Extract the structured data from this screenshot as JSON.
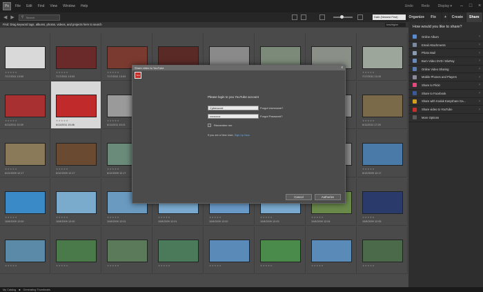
{
  "app": {
    "logo_text": "Ps"
  },
  "menubar": {
    "items": [
      "File",
      "Edit",
      "Find",
      "View",
      "Window",
      "Help"
    ],
    "undo": "Undo",
    "redo": "Redo",
    "display": "Display ▾"
  },
  "toolbar": {
    "search_placeholder": "Search",
    "sort_value": "Date (Newest First)"
  },
  "hint": {
    "text": "Find: Drag keyword tags, albums, photos, videos, and projects here to search",
    "right_label": "best/higher"
  },
  "grid": {
    "cells": [
      {
        "date": "7/17/2011 13:00",
        "color": "#d9d9d9"
      },
      {
        "date": "7/17/2011 13:03",
        "color": "#6a2a2a"
      },
      {
        "date": "7/17/2011 13:03",
        "color": "#7a3a30"
      },
      {
        "date": "7/17/2011 13:03",
        "color": "#5a2a26"
      },
      {
        "date": "7/17/2011 13:06",
        "color": "#8a8a8a"
      },
      {
        "date": "7/17/2011 13:06",
        "color": "#7c8a7a"
      },
      {
        "date": "7/17/2011 13:08",
        "color": "#8a9088"
      },
      {
        "date": "7/17/2011 13:10",
        "color": "#9ca69a"
      },
      {
        "date": "6/11/2011 15:39",
        "color": "#a83030"
      },
      {
        "date": "6/11/2011 15:46",
        "color": "#c02a2a"
      },
      {
        "date": "6/11/2011 16:21",
        "color": "#9a9a9a"
      },
      {
        "date": "",
        "color": "#8a8a8a"
      },
      {
        "date": "",
        "color": "#8a8a8a"
      },
      {
        "date": "",
        "color": "#8a8a8a"
      },
      {
        "date": "",
        "color": "#8a8a8a"
      },
      {
        "date": "6/11/2011 17:20",
        "color": "#7a6a4a"
      },
      {
        "date": "6/12/2009 12:17",
        "color": "#8a7a5a"
      },
      {
        "date": "6/12/2009 12:17",
        "color": "#6a4a30"
      },
      {
        "date": "6/12/2009 12:17",
        "color": "#6a8a7a"
      },
      {
        "date": "",
        "color": "#8a8a8a"
      },
      {
        "date": "",
        "color": "#8a8a8a"
      },
      {
        "date": "",
        "color": "#8a8a8a"
      },
      {
        "date": "",
        "color": "#8a8a8a"
      },
      {
        "date": "6/12/2009 12:17",
        "color": "#4a7aa8"
      },
      {
        "date": "10/8/2009 12:00",
        "color": "#3a8ac8"
      },
      {
        "date": "10/8/2009 12:00",
        "color": "#7aaacc"
      },
      {
        "date": "10/8/2009 12:01",
        "color": "#6a9ac0"
      },
      {
        "date": "10/8/2009 12:01",
        "color": "#7aaad0"
      },
      {
        "date": "10/8/2009 12:02",
        "color": "#6a9ac8"
      },
      {
        "date": "10/8/2009 12:03",
        "color": "#7aaad0"
      },
      {
        "date": "10/8/2009 12:04",
        "color": "#6a8a4a"
      },
      {
        "date": "10/8/2009 12:05",
        "color": "#2a3a6a"
      },
      {
        "date": "",
        "color": "#5a8aa8"
      },
      {
        "date": "",
        "color": "#4a7a4a"
      },
      {
        "date": "",
        "color": "#5a7a5a"
      },
      {
        "date": "",
        "color": "#4a7a5a"
      },
      {
        "date": "",
        "color": "#5a8ab8"
      },
      {
        "date": "",
        "color": "#4a8a4a"
      },
      {
        "date": "",
        "color": "#5a8ab8"
      },
      {
        "date": "",
        "color": "#4a6a4a"
      }
    ],
    "stars": "★★★★★"
  },
  "panel": {
    "tabs": [
      "Organize",
      "Fix",
      "+",
      "Create",
      "Share"
    ],
    "heading": "How would you like to share?",
    "items": [
      {
        "label": "Online Album",
        "color": "#5a8ad0",
        "icon": "online-album-icon"
      },
      {
        "label": "Email Attachments",
        "color": "#7a8aa0",
        "icon": "email-icon"
      },
      {
        "label": "Photo Mail",
        "color": "#8a9ab0",
        "icon": "photo-mail-icon"
      },
      {
        "label": "Burn Video DVD / BluRay",
        "color": "#6a8ab8",
        "icon": "disc-icon"
      },
      {
        "label": "Online Video Sharing",
        "color": "#5a7ab0",
        "icon": "video-sharing-icon"
      },
      {
        "label": "Mobile Phones and Players",
        "color": "#8a8a9a",
        "icon": "mobile-icon"
      },
      {
        "label": "Share to Flickr",
        "color": "#e04a7a",
        "icon": "flickr-icon"
      },
      {
        "label": "Share to Facebook",
        "color": "#3b5998",
        "icon": "facebook-icon"
      },
      {
        "label": "Share with Kodak Easyshare Ga...",
        "color": "#d4a020",
        "icon": "kodak-icon"
      },
      {
        "label": "Share video to YouTube",
        "color": "#c4302b",
        "icon": "youtube-icon"
      },
      {
        "label": "More Options",
        "color": "#5a5a5a",
        "icon": "more-options-icon"
      }
    ]
  },
  "dialog": {
    "title": "Share video to YouTube",
    "close": "x",
    "logo_text": "You",
    "prompt": "Please login to you YouTube account",
    "username_value": "Cyberword",
    "password_value": "•••••••••••",
    "forgot_username": "Forgot Username?",
    "forgot_password": "Forgot Password?",
    "remember_label": "Remember me",
    "new_user_text": "If you are a New User, ",
    "signup_text": "Sign Up Now",
    "cancel_label": "Cancel",
    "authorize_label": "Authorize"
  },
  "status": {
    "catalog": "My Catalog",
    "task": "Generating Thumbnails"
  }
}
